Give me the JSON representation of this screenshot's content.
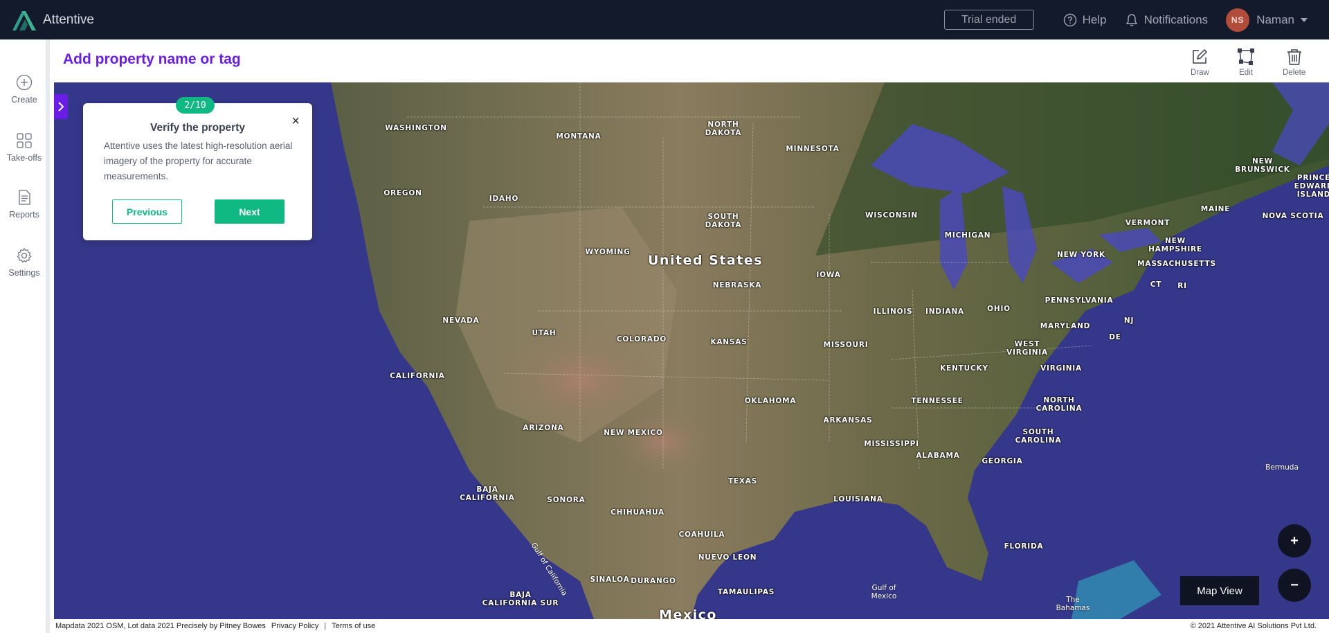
{
  "app": {
    "name": "Attentive"
  },
  "topbar": {
    "trial_label": "Trial ended",
    "help_label": "Help",
    "notifications_label": "Notifications",
    "user_initials": "NS",
    "user_name": "Naman"
  },
  "nav": {
    "items": [
      {
        "label": "Create",
        "icon": "plus-circle-icon"
      },
      {
        "label": "Take-offs",
        "icon": "grid-icon"
      },
      {
        "label": "Reports",
        "icon": "document-icon"
      },
      {
        "label": "Settings",
        "icon": "gear-icon"
      }
    ]
  },
  "header": {
    "title": "Add property name or tag",
    "tools": [
      {
        "label": "Draw",
        "icon": "pencil-square-icon"
      },
      {
        "label": "Edit",
        "icon": "polygon-edit-icon"
      },
      {
        "label": "Delete",
        "icon": "trash-icon"
      }
    ]
  },
  "tour": {
    "step": "2/10",
    "title": "Verify the property",
    "body": "Attentive uses the latest high-resolution aerial imagery of the property for accurate measurements.",
    "previous_label": "Previous",
    "next_label": "Next",
    "close_label": "×"
  },
  "map": {
    "country_label": "United States",
    "labels": [
      "WASHINGTON",
      "MONTANA",
      "NORTH\nDAKOTA",
      "MINNESOTA",
      "OREGON",
      "IDAHO",
      "WYOMING",
      "SOUTH\nDAKOTA",
      "WISCONSIN",
      "MICHIGAN",
      "NEW YORK",
      "VERMONT",
      "NEW\nHAMPSHIRE",
      "MAINE",
      "NEW\nBRUNSWICK",
      "PRINCE\nEDWARD\nISLAND",
      "NOVA SCOTIA",
      "MASSACHUSETTS",
      "CT",
      "RI",
      "NEBRASKA",
      "IOWA",
      "PENNSYLVANIA",
      "NEVADA",
      "UTAH",
      "COLORADO",
      "ILLINOIS",
      "INDIANA",
      "OHIO",
      "NJ",
      "MARYLAND",
      "DE",
      "KANSAS",
      "MISSOURI",
      "WEST\nVIRGINIA",
      "VIRGINIA",
      "CALIFORNIA",
      "KENTUCKY",
      "OKLAHOMA",
      "TENNESSEE",
      "NORTH\nCAROLINA",
      "ARKANSAS",
      "ARIZONA",
      "NEW MEXICO",
      "MISSISSIPPI",
      "SOUTH\nCAROLINA",
      "ALABAMA",
      "GEORGIA",
      "TEXAS",
      "BAJA\nCALIFORNIA",
      "SONORA",
      "LOUISIANA",
      "CHIHUAHUA",
      "COAHUILA",
      "FLORIDA",
      "NUEVO LEON",
      "BAJA\nCALIFORNIA SUR",
      "SINALOA",
      "DURANGO",
      "TAMAULIPAS",
      "Mexico",
      "Bermuda",
      "Gulf of\nMexico",
      "The\nBahamas",
      "Gulf of California"
    ],
    "zoom_in_label": "+",
    "zoom_out_label": "−",
    "view_label": "Map View"
  },
  "footer": {
    "attribution": "Mapdata 2021 OSM, Lot data 2021 Precisely by Pitney Bowes",
    "privacy": "Privacy Policy",
    "separator": "|",
    "terms": "Terms of use",
    "copyright": "© 2021  Attentive AI Solutions Pvt Ltd."
  },
  "colors": {
    "accent": "#6a1de6",
    "primary_green": "#10b981",
    "topbar_bg": "#131a2b",
    "ocean": "#3a3c8c"
  }
}
